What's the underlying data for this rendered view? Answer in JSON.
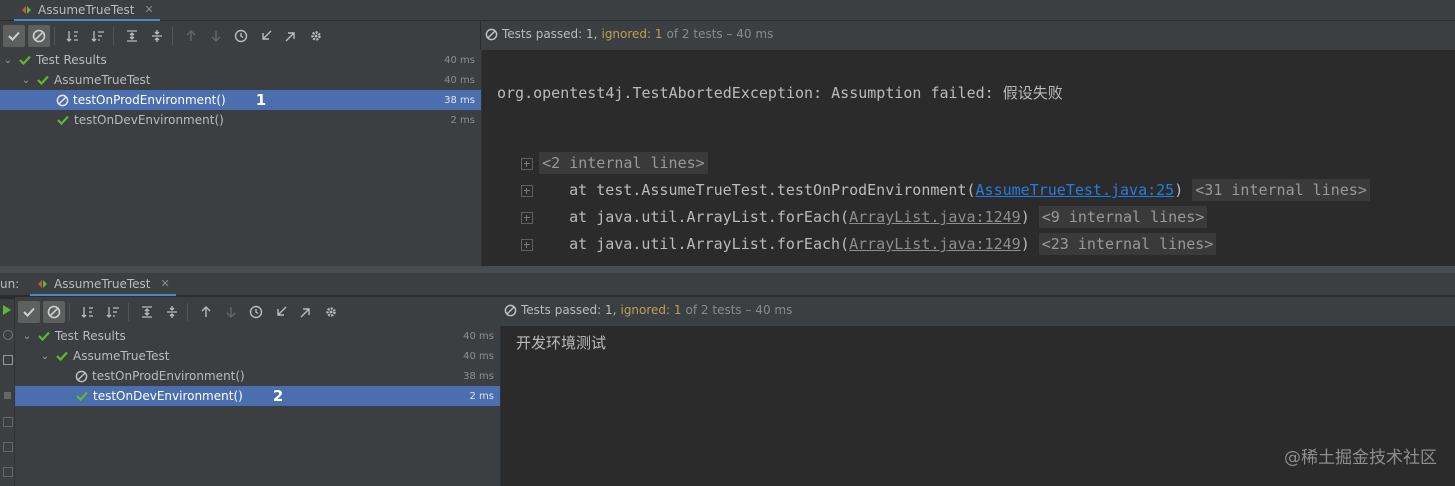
{
  "colors": {
    "bg": "#2b2b2b",
    "panel": "#3c3f41",
    "selection": "#4b6eaf",
    "pass": "#5fb832",
    "ignored": "#b9a05a",
    "link": "#287bde"
  },
  "top": {
    "tab_label": "AssumeTrueTest",
    "status": {
      "passed": "Tests passed: 1,",
      "ignored": "ignored: 1",
      "rest": "of 2 tests – 40 ms"
    },
    "tree": [
      {
        "label": "Test Results",
        "duration": "40 ms",
        "icon": "check-icon"
      },
      {
        "label": "AssumeTrueTest",
        "duration": "40 ms",
        "icon": "check-icon"
      },
      {
        "label": "testOnProdEnvironment()",
        "duration": "38 ms",
        "icon": "ignored-icon",
        "selected": true,
        "marker": "1"
      },
      {
        "label": "testOnDevEnvironment()",
        "duration": "2 ms",
        "icon": "check-icon"
      }
    ],
    "console": {
      "exception": "org.opentest4j.TestAbortedException: Assumption failed: 假设失败",
      "internal1": "<2 internal lines>",
      "trace1_prefix": "at test.AssumeTrueTest.testOnProdEnvironment(",
      "trace1_link": "AssumeTrueTest.java:25",
      "trace1_suffix": ")",
      "trace1_internal": "<31 internal lines>",
      "trace2_prefix": "at java.util.ArrayList.forEach(",
      "trace2_link": "ArrayList.java:1249",
      "trace2_suffix": ")",
      "trace2_internal": "<9 internal lines>",
      "trace3_prefix": "at java.util.ArrayList.forEach(",
      "trace3_link": "ArrayList.java:1249",
      "trace3_suffix": ")",
      "trace3_internal": "<23 internal lines>"
    }
  },
  "bottom": {
    "run_label": "un:",
    "tab_label": "AssumeTrueTest",
    "status": {
      "passed": "Tests passed: 1,",
      "ignored": "ignored: 1",
      "rest": "of 2 tests – 40 ms"
    },
    "tree": [
      {
        "label": "Test Results",
        "duration": "40 ms",
        "icon": "check-icon"
      },
      {
        "label": "AssumeTrueTest",
        "duration": "40 ms",
        "icon": "check-icon"
      },
      {
        "label": "testOnProdEnvironment()",
        "duration": "38 ms",
        "icon": "ignored-icon"
      },
      {
        "label": "testOnDevEnvironment()",
        "duration": "2 ms",
        "icon": "check-icon",
        "selected": true,
        "marker": "2"
      }
    ],
    "console": {
      "output": "开发环境测试"
    }
  },
  "watermark": "@稀土掘金技术社区"
}
